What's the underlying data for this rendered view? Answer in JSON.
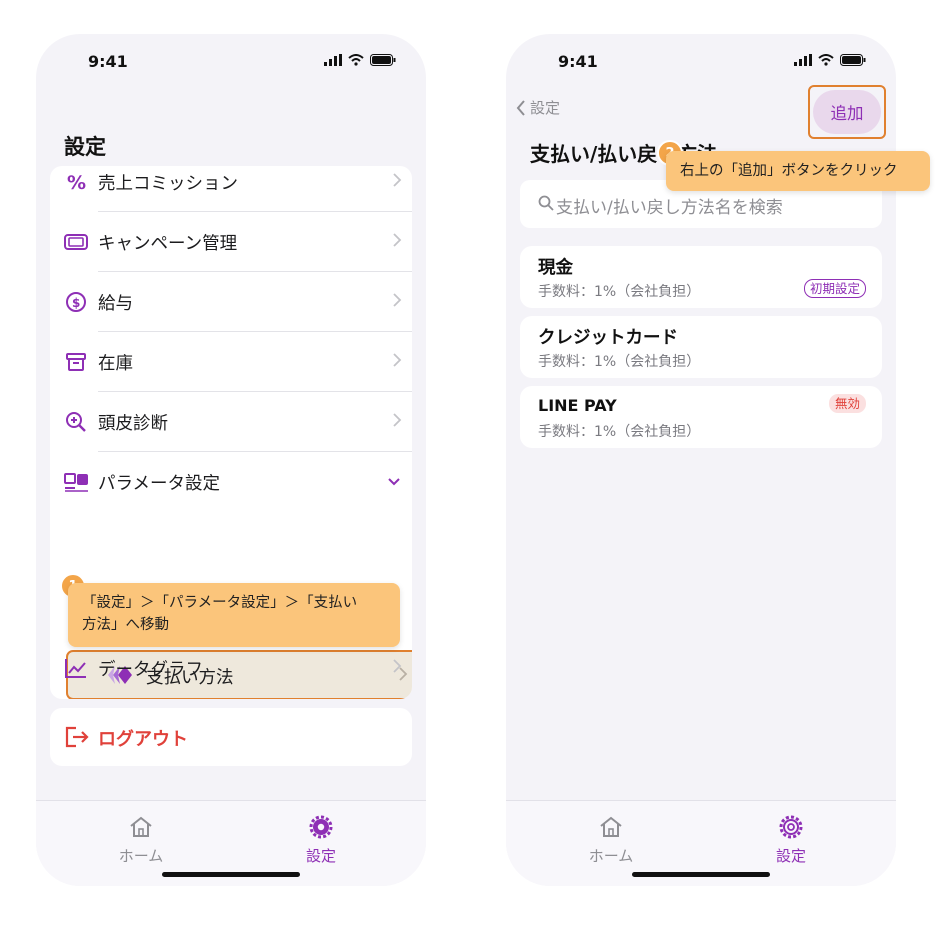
{
  "left": {
    "status_time": "9:41",
    "page_title": "設定",
    "items": [
      {
        "label": "売上コミッション",
        "icon": "percent-icon"
      },
      {
        "label": "キャンペーン管理",
        "icon": "ticket-icon"
      },
      {
        "label": "給与",
        "icon": "salary-icon"
      },
      {
        "label": "在庫",
        "icon": "archive-box-icon"
      },
      {
        "label": "頭皮診断",
        "icon": "zoom-in-icon"
      },
      {
        "label": "パラメータ設定",
        "icon": "parameters-icon"
      }
    ],
    "sub_item": {
      "label": "支払い方法",
      "icon": "payment-diamond-icon"
    },
    "hidden_item": {
      "label": "データグラフ",
      "icon": "chart-line-icon"
    },
    "logout_label": "ログアウト",
    "tooltip": {
      "number": "1",
      "text_line1": "「設定」＞「パラメータ設定」＞「支払い",
      "text_line2": "方法」へ移動"
    },
    "tabs": [
      {
        "label": "ホーム",
        "icon": "home-icon"
      },
      {
        "label": "設定",
        "icon": "gear-icon"
      }
    ]
  },
  "right": {
    "status_time": "9:41",
    "back_label": "設定",
    "add_label": "追加",
    "page_title": "支払い/払い戻し方法",
    "search_placeholder": "支払い/払い戻し方法名を検索",
    "tooltip": {
      "number": "2",
      "text": "右上の「追加」ボタンをクリック"
    },
    "methods": [
      {
        "name": "現金",
        "fee": "手数料：1%（会社負担）",
        "badge": "初期設定"
      },
      {
        "name": "クレジットカード",
        "fee": "手数料：1%（会社負担）",
        "badge": ""
      },
      {
        "name": "LINE PAY",
        "fee": "手数料：1%（会社負担）",
        "badge": "無効"
      }
    ],
    "tabs": [
      {
        "label": "ホーム",
        "icon": "home-icon"
      },
      {
        "label": "設定",
        "icon": "gear-icon"
      }
    ]
  },
  "colors": {
    "accent": "#8e2fb5",
    "highlight_border": "#e0802f",
    "tooltip_bg": "#fbc57b",
    "danger": "#e0413a"
  }
}
